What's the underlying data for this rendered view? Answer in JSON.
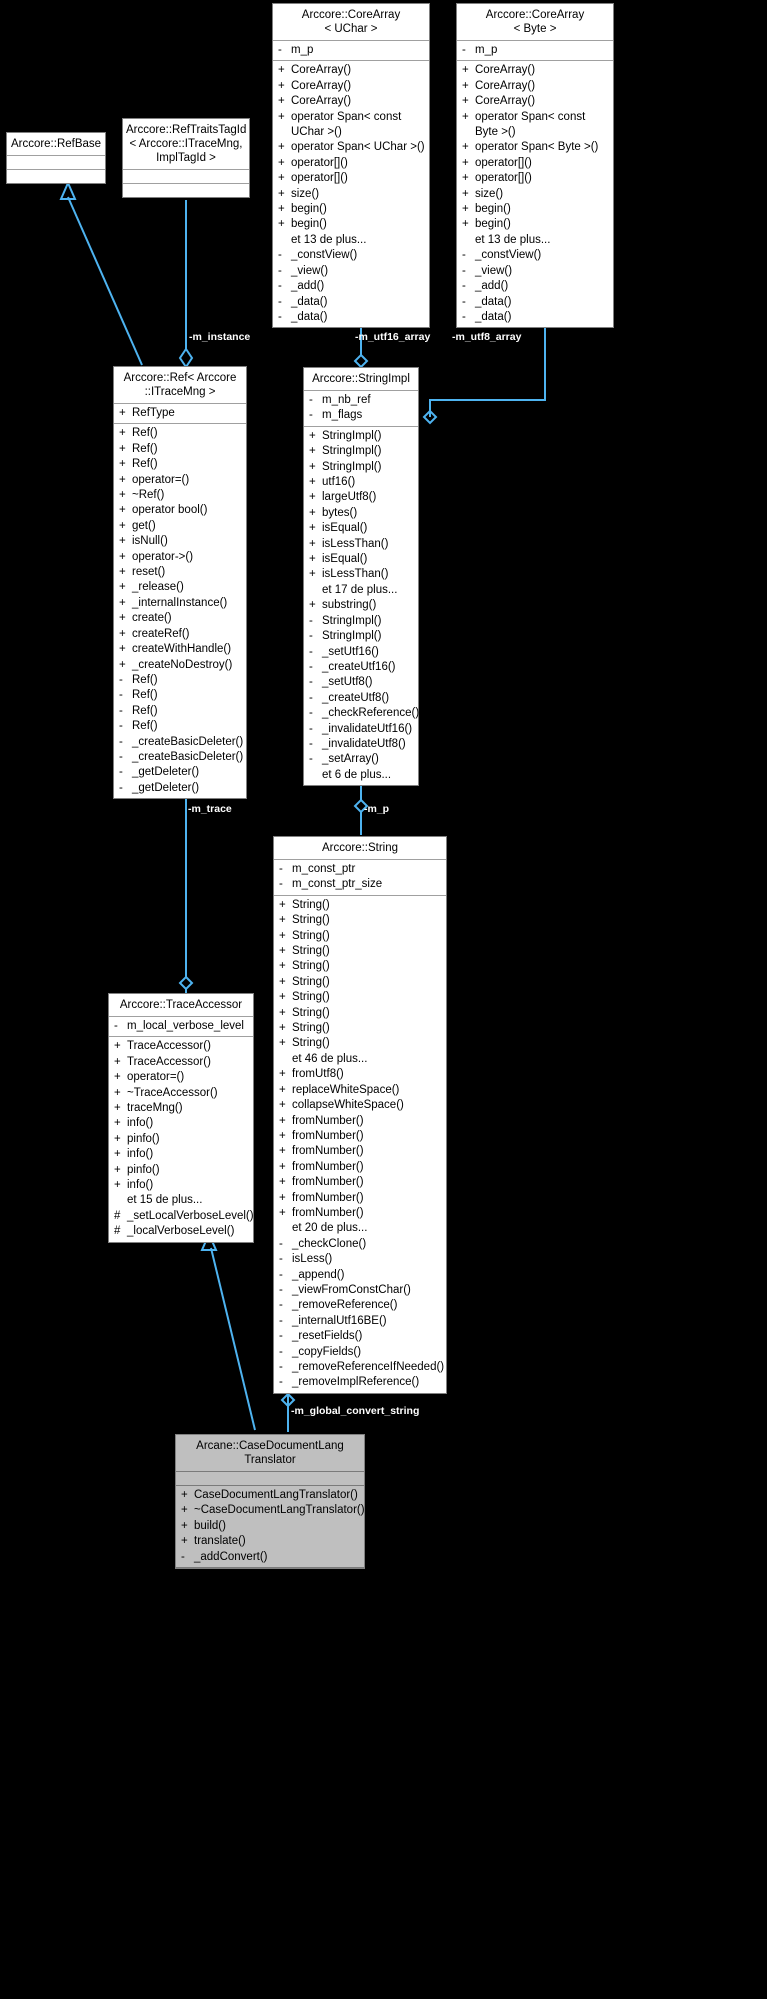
{
  "diagram": {
    "kind": "uml-class-collaboration-diagram",
    "background_color": "#000000",
    "box_fill": "#ffffff",
    "box_border": "#808080",
    "edge_color": "#4eb3f0",
    "label_color": "#ffffff",
    "highlight_box_fill": "#bfbfbf",
    "more_suffix": "et N de plus..."
  },
  "classes": {
    "refbase": {
      "title": "Arccore::RefBase",
      "attributes": [],
      "methods": []
    },
    "reftraitstagid": {
      "title": "Arccore::RefTraitsTagId\n< Arccore::ITraceMng,\nImplTagId >",
      "attributes": [],
      "methods": []
    },
    "corearray_uchar": {
      "title": "Arccore::CoreArray\n< UChar >",
      "attributes": [
        {
          "vis": "-",
          "name": "m_p"
        }
      ],
      "methods": [
        {
          "vis": "+",
          "name": "CoreArray()"
        },
        {
          "vis": "+",
          "name": "CoreArray()"
        },
        {
          "vis": "+",
          "name": "CoreArray()"
        },
        {
          "vis": "+",
          "name": "operator Span< const\n  UChar >()"
        },
        {
          "vis": "+",
          "name": "operator Span< UChar >()"
        },
        {
          "vis": "+",
          "name": "operator[]()"
        },
        {
          "vis": "+",
          "name": "operator[]()"
        },
        {
          "vis": "+",
          "name": "size()"
        },
        {
          "vis": "+",
          "name": "begin()"
        },
        {
          "vis": "+",
          "name": "begin()"
        },
        {
          "vis": " ",
          "name": "et 13 de plus..."
        },
        {
          "vis": "-",
          "name": "_constView()"
        },
        {
          "vis": "-",
          "name": "_view()"
        },
        {
          "vis": "-",
          "name": "_add()"
        },
        {
          "vis": "-",
          "name": "_data()"
        },
        {
          "vis": "-",
          "name": "_data()"
        }
      ]
    },
    "corearray_byte": {
      "title": "Arccore::CoreArray\n< Byte >",
      "attributes": [
        {
          "vis": "-",
          "name": "m_p"
        }
      ],
      "methods": [
        {
          "vis": "+",
          "name": "CoreArray()"
        },
        {
          "vis": "+",
          "name": "CoreArray()"
        },
        {
          "vis": "+",
          "name": "CoreArray()"
        },
        {
          "vis": "+",
          "name": "operator Span< const\n  Byte >()"
        },
        {
          "vis": "+",
          "name": "operator Span< Byte >()"
        },
        {
          "vis": "+",
          "name": "operator[]()"
        },
        {
          "vis": "+",
          "name": "operator[]()"
        },
        {
          "vis": "+",
          "name": "size()"
        },
        {
          "vis": "+",
          "name": "begin()"
        },
        {
          "vis": "+",
          "name": "begin()"
        },
        {
          "vis": " ",
          "name": "et 13 de plus..."
        },
        {
          "vis": "-",
          "name": "_constView()"
        },
        {
          "vis": "-",
          "name": "_view()"
        },
        {
          "vis": "-",
          "name": "_add()"
        },
        {
          "vis": "-",
          "name": "_data()"
        },
        {
          "vis": "-",
          "name": "_data()"
        }
      ]
    },
    "ref_itracemng": {
      "title": "Arccore::Ref< Arccore\n::ITraceMng >",
      "attributes": [
        {
          "vis": "+",
          "name": "RefType"
        }
      ],
      "methods": [
        {
          "vis": "+",
          "name": "Ref()"
        },
        {
          "vis": "+",
          "name": "Ref()"
        },
        {
          "vis": "+",
          "name": "Ref()"
        },
        {
          "vis": "+",
          "name": "operator=()"
        },
        {
          "vis": "+",
          "name": "~Ref()"
        },
        {
          "vis": "+",
          "name": "operator bool()"
        },
        {
          "vis": "+",
          "name": "get()"
        },
        {
          "vis": "+",
          "name": "isNull()"
        },
        {
          "vis": "+",
          "name": "operator->()"
        },
        {
          "vis": "+",
          "name": "reset()"
        },
        {
          "vis": "+",
          "name": "_release()"
        },
        {
          "vis": "+",
          "name": "_internalInstance()"
        },
        {
          "vis": "+",
          "name": "create()"
        },
        {
          "vis": "+",
          "name": "createRef()"
        },
        {
          "vis": "+",
          "name": "createWithHandle()"
        },
        {
          "vis": "+",
          "name": "_createNoDestroy()"
        },
        {
          "vis": "-",
          "name": "Ref()"
        },
        {
          "vis": "-",
          "name": "Ref()"
        },
        {
          "vis": "-",
          "name": "Ref()"
        },
        {
          "vis": "-",
          "name": "Ref()"
        },
        {
          "vis": "-",
          "name": "_createBasicDeleter()"
        },
        {
          "vis": "-",
          "name": "_createBasicDeleter()"
        },
        {
          "vis": "-",
          "name": "_getDeleter()"
        },
        {
          "vis": "-",
          "name": "_getDeleter()"
        }
      ]
    },
    "stringimpl": {
      "title": "Arccore::StringImpl",
      "attributes": [
        {
          "vis": "-",
          "name": "m_nb_ref"
        },
        {
          "vis": "-",
          "name": "m_flags"
        }
      ],
      "methods": [
        {
          "vis": "+",
          "name": "StringImpl()"
        },
        {
          "vis": "+",
          "name": "StringImpl()"
        },
        {
          "vis": "+",
          "name": "StringImpl()"
        },
        {
          "vis": "+",
          "name": "utf16()"
        },
        {
          "vis": "+",
          "name": "largeUtf8()"
        },
        {
          "vis": "+",
          "name": "bytes()"
        },
        {
          "vis": "+",
          "name": "isEqual()"
        },
        {
          "vis": "+",
          "name": "isLessThan()"
        },
        {
          "vis": "+",
          "name": "isEqual()"
        },
        {
          "vis": "+",
          "name": "isLessThan()"
        },
        {
          "vis": " ",
          "name": "et 17 de plus..."
        },
        {
          "vis": "+",
          "name": "substring()"
        },
        {
          "vis": "-",
          "name": "StringImpl()"
        },
        {
          "vis": "-",
          "name": "StringImpl()"
        },
        {
          "vis": "-",
          "name": "_setUtf16()"
        },
        {
          "vis": "-",
          "name": "_createUtf16()"
        },
        {
          "vis": "-",
          "name": "_setUtf8()"
        },
        {
          "vis": "-",
          "name": "_createUtf8()"
        },
        {
          "vis": "-",
          "name": "_checkReference()"
        },
        {
          "vis": "-",
          "name": "_invalidateUtf16()"
        },
        {
          "vis": "-",
          "name": "_invalidateUtf8()"
        },
        {
          "vis": "-",
          "name": "_setArray()"
        },
        {
          "vis": " ",
          "name": "et 6 de plus..."
        }
      ]
    },
    "string": {
      "title": "Arccore::String",
      "attributes": [
        {
          "vis": "-",
          "name": "m_const_ptr"
        },
        {
          "vis": "-",
          "name": "m_const_ptr_size"
        }
      ],
      "methods": [
        {
          "vis": "+",
          "name": "String()"
        },
        {
          "vis": "+",
          "name": "String()"
        },
        {
          "vis": "+",
          "name": "String()"
        },
        {
          "vis": "+",
          "name": "String()"
        },
        {
          "vis": "+",
          "name": "String()"
        },
        {
          "vis": "+",
          "name": "String()"
        },
        {
          "vis": "+",
          "name": "String()"
        },
        {
          "vis": "+",
          "name": "String()"
        },
        {
          "vis": "+",
          "name": "String()"
        },
        {
          "vis": "+",
          "name": "String()"
        },
        {
          "vis": " ",
          "name": "et 46 de plus..."
        },
        {
          "vis": "+",
          "name": "fromUtf8()"
        },
        {
          "vis": "+",
          "name": "replaceWhiteSpace()"
        },
        {
          "vis": "+",
          "name": "collapseWhiteSpace()"
        },
        {
          "vis": "+",
          "name": "fromNumber()"
        },
        {
          "vis": "+",
          "name": "fromNumber()"
        },
        {
          "vis": "+",
          "name": "fromNumber()"
        },
        {
          "vis": "+",
          "name": "fromNumber()"
        },
        {
          "vis": "+",
          "name": "fromNumber()"
        },
        {
          "vis": "+",
          "name": "fromNumber()"
        },
        {
          "vis": "+",
          "name": "fromNumber()"
        },
        {
          "vis": " ",
          "name": "et 20 de plus..."
        },
        {
          "vis": "-",
          "name": "_checkClone()"
        },
        {
          "vis": "-",
          "name": "isLess()"
        },
        {
          "vis": "-",
          "name": "_append()"
        },
        {
          "vis": "-",
          "name": "_viewFromConstChar()"
        },
        {
          "vis": "-",
          "name": "_removeReference()"
        },
        {
          "vis": "-",
          "name": "_internalUtf16BE()"
        },
        {
          "vis": "-",
          "name": "_resetFields()"
        },
        {
          "vis": "-",
          "name": "_copyFields()"
        },
        {
          "vis": "-",
          "name": "_removeReferenceIfNeeded()"
        },
        {
          "vis": "-",
          "name": "_removeImplReference()"
        }
      ]
    },
    "traceaccessor": {
      "title": "Arccore::TraceAccessor",
      "attributes": [
        {
          "vis": "-",
          "name": "m_local_verbose_level"
        }
      ],
      "methods": [
        {
          "vis": "+",
          "name": "TraceAccessor()"
        },
        {
          "vis": "+",
          "name": "TraceAccessor()"
        },
        {
          "vis": "+",
          "name": "operator=()"
        },
        {
          "vis": "+",
          "name": "~TraceAccessor()"
        },
        {
          "vis": "+",
          "name": "traceMng()"
        },
        {
          "vis": "+",
          "name": "info()"
        },
        {
          "vis": "+",
          "name": "pinfo()"
        },
        {
          "vis": "+",
          "name": "info()"
        },
        {
          "vis": "+",
          "name": "pinfo()"
        },
        {
          "vis": "+",
          "name": "info()"
        },
        {
          "vis": " ",
          "name": "et 15 de plus..."
        },
        {
          "vis": "#",
          "name": "_setLocalVerboseLevel()"
        },
        {
          "vis": "#",
          "name": "_localVerboseLevel()"
        }
      ]
    },
    "casedocumentlangtranslator": {
      "title": "Arcane::CaseDocumentLang\nTranslator",
      "attributes": [],
      "methods": [
        {
          "vis": "+",
          "name": "CaseDocumentLangTranslator()"
        },
        {
          "vis": "+",
          "name": "~CaseDocumentLangTranslator()"
        },
        {
          "vis": "+",
          "name": "build()"
        },
        {
          "vis": "+",
          "name": "translate()"
        },
        {
          "vis": "-",
          "name": "_addConvert()"
        }
      ]
    }
  },
  "edge_labels": {
    "m_instance": "-m_instance",
    "m_utf16_array": "-m_utf16_array",
    "m_utf8_array": "-m_utf8_array",
    "m_trace": "-m_trace",
    "m_p": "-m_p",
    "m_global_convert_string": "-m_global_convert_string"
  }
}
